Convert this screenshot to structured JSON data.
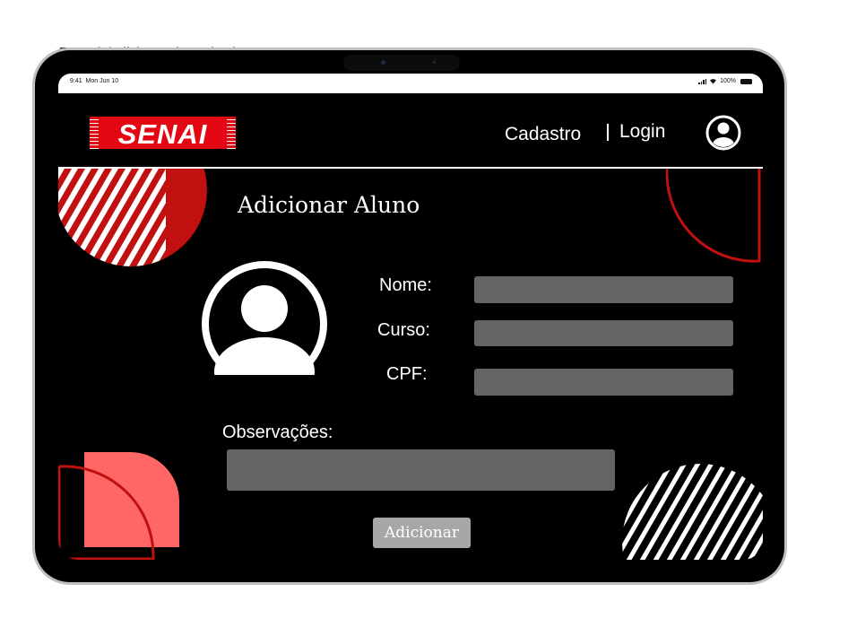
{
  "frame": {
    "label": "Exemplo/Adicionar Aluno - iPad"
  },
  "statusbar": {
    "time": "9:41",
    "date": "Mon Jun 10",
    "battery": "100%"
  },
  "header": {
    "logo_text": "SENAI",
    "nav": {
      "cadastro": "Cadastro",
      "login": "Login"
    },
    "user_icon": "user-circle-icon"
  },
  "main": {
    "title": "Adicionar Aluno",
    "avatar_icon": "user-avatar-icon",
    "fields": {
      "nome": {
        "label": "Nome:",
        "value": ""
      },
      "curso": {
        "label": "Curso:",
        "value": ""
      },
      "cpf": {
        "label": "CPF:",
        "value": ""
      },
      "observacoes": {
        "label": "Observações:",
        "value": ""
      }
    },
    "submit_label": "Adicionar"
  },
  "colors": {
    "brand_red": "#e30613",
    "dark_red": "#c01010",
    "salmon": "#ff6666",
    "field_gray": "#646464",
    "button_gray": "#a7a7a7",
    "background": "#000000"
  }
}
